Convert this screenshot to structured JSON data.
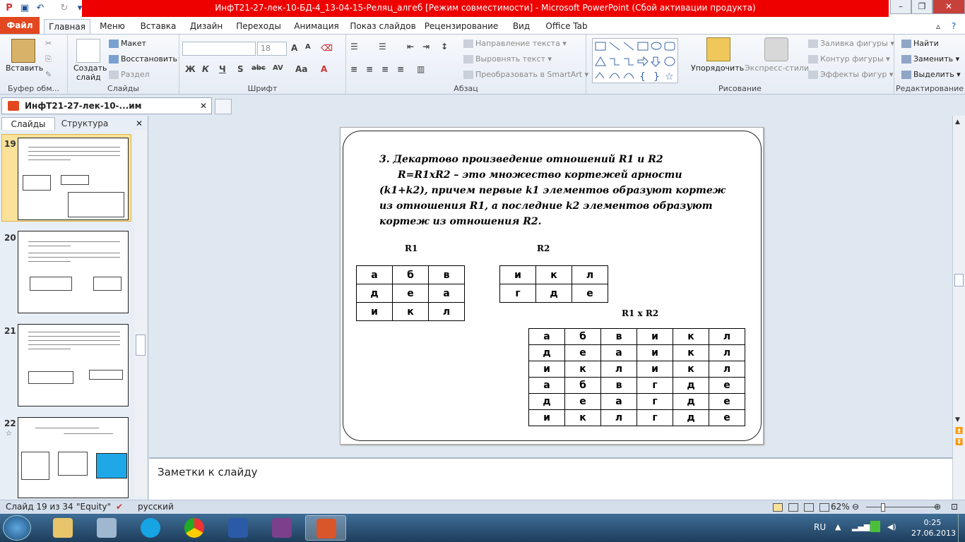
{
  "window": {
    "title": "ИнфТ21-27-лек-10-БД-4_13-04-15-Реляц_алгеб [Режим совместимости]  -  Microsoft PowerPoint (Сбой активации продукта)",
    "minimize": "–",
    "restore": "❐",
    "close": "✕"
  },
  "tabs": [
    "Файл",
    "Главная",
    "Меню",
    "Вставка",
    "Дизайн",
    "Переходы",
    "Анимация",
    "Показ слайдов",
    "Рецензирование",
    "Вид",
    "Office Tab"
  ],
  "ribbon": {
    "clipboard": {
      "paste": "Вставить",
      "label": "Буфер обм..."
    },
    "slides": {
      "create": "Создать",
      "create2": "слайд",
      "layout": "Макет",
      "reset": "Восстановить",
      "section": "Раздел",
      "label": "Слайды"
    },
    "font": {
      "size": "18",
      "label": "Шрифт",
      "bold": "Ж",
      "italic": "К",
      "underline": "Ч",
      "shadow": "S",
      "strike": "abc",
      "spacing": "AV",
      "case": "Aa"
    },
    "paragraph": {
      "direction": "Направление текста",
      "align": "Выровнять текст",
      "smartart": "Преобразовать в SmartArt",
      "label": "Абзац"
    },
    "drawing": {
      "arrange": "Упорядочить",
      "styles": "Экспресс-стили",
      "fill": "Заливка фигуры",
      "outline": "Контур фигуры",
      "effects": "Эффекты фигур",
      "label": "Рисование"
    },
    "editing": {
      "find": "Найти",
      "replace": "Заменить",
      "select": "Выделить",
      "label": "Редактирование"
    }
  },
  "doctab": {
    "title": "ИнфТ21-27-лек-10-...им совместимости]",
    "close": "✕"
  },
  "panel": {
    "tab_slides": "Слайды",
    "tab_outline": "Структура",
    "close": "✕"
  },
  "thumbnails": [
    {
      "num": "19"
    },
    {
      "num": "20"
    },
    {
      "num": "21"
    },
    {
      "num": "22"
    }
  ],
  "slide": {
    "heading_a": "3. Декартово произведение отношений R1 и R2",
    "heading_b": "R=R1xR2 –",
    "body": "это множество кортежей арности (k1+k2), причем первые k1 элементов образуют кортеж из отношения R1, а последние k2 элементов образуют кортеж из отношения R2.",
    "r1_label": "R1",
    "r2_label": "R2",
    "r3_label": "R1 x R2",
    "r1": [
      [
        "а",
        "б",
        "в"
      ],
      [
        "д",
        "е",
        "а"
      ],
      [
        "и",
        "к",
        "л"
      ]
    ],
    "r2": [
      [
        "и",
        "к",
        "л"
      ],
      [
        "г",
        "д",
        "е"
      ]
    ],
    "r3": [
      [
        "а",
        "б",
        "в",
        "и",
        "к",
        "л"
      ],
      [
        "д",
        "е",
        "а",
        "и",
        "к",
        "л"
      ],
      [
        "и",
        "к",
        "л",
        "и",
        "к",
        "л"
      ],
      [
        "а",
        "б",
        "в",
        "г",
        "д",
        "е"
      ],
      [
        "д",
        "е",
        "а",
        "г",
        "д",
        "е"
      ],
      [
        "и",
        "к",
        "л",
        "г",
        "д",
        "е"
      ]
    ]
  },
  "notes": {
    "placeholder": "Заметки к слайду"
  },
  "status": {
    "slide": "Слайд 19 из 34",
    "theme": "\"Equity\"",
    "lang": "русский",
    "zoom": "62%"
  },
  "tray": {
    "lang": "RU",
    "time": "0:25",
    "date": "27.06.2013"
  },
  "colors": {
    "title_red": "#ee0000",
    "file_tab": "#e2471f",
    "ribbon": "#e6ecf5",
    "taskbar": "#2a4f74",
    "accent_blue": "#1fa8e8"
  }
}
